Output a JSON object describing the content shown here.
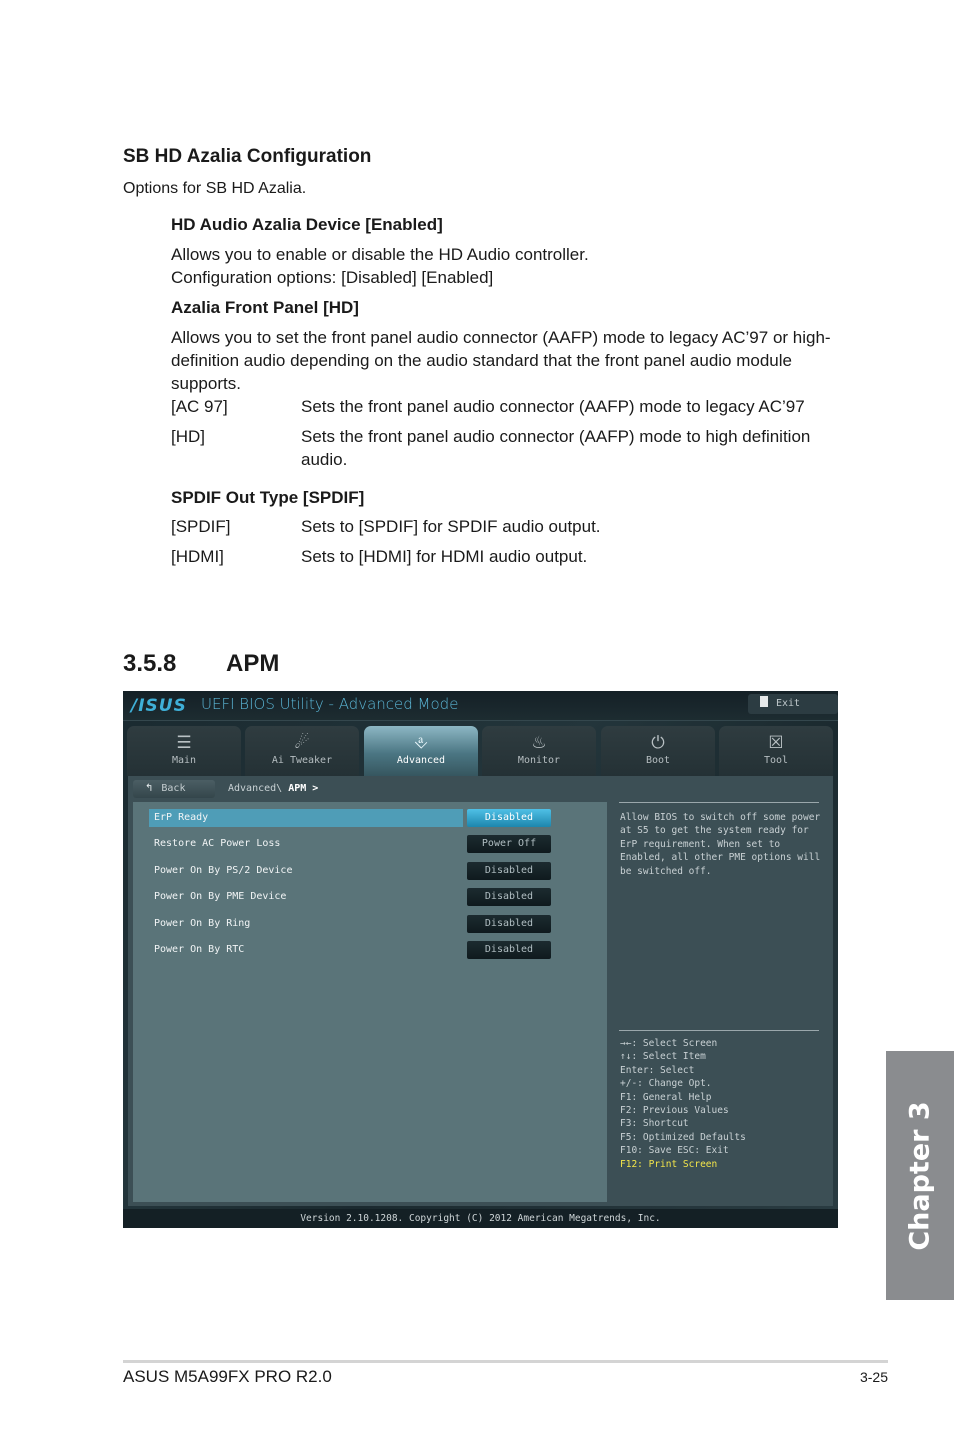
{
  "document": {
    "section": {
      "title": "SB HD Azalia Configuration",
      "intro": "Options for SB HD Azalia.",
      "items": [
        {
          "title": "HD Audio Azalia Device [Enabled]",
          "lines": [
            "Allows you to enable or disable the HD Audio controller.",
            "Configuration options: [Disabled] [Enabled]"
          ]
        },
        {
          "title": "Azalia Front Panel [HD]",
          "description": "Allows you to set the front panel audio connector (AAFP) mode to legacy AC’97 or high-definition audio depending on the audio standard that the front panel audio module supports.",
          "options": [
            {
              "key": "[AC 97]",
              "desc": "Sets the front panel audio connector (AAFP) mode to legacy AC’97"
            },
            {
              "key": "[HD]",
              "desc": "Sets the front panel audio connector (AAFP) mode to high definition audio."
            }
          ]
        },
        {
          "title": "SPDIF Out Type [SPDIF]",
          "options": [
            {
              "key": "[SPDIF]",
              "desc": "Sets to [SPDIF] for SPDIF audio output."
            },
            {
              "key": "[HDMI]",
              "desc": "Sets to [HDMI] for HDMI audio output."
            }
          ]
        }
      ]
    },
    "apm_heading": {
      "number": "3.5.8",
      "title": "APM"
    }
  },
  "bios": {
    "brand": "/ISUS",
    "title": "UEFI BIOS Utility - Advanced Mode",
    "exit_label": "Exit",
    "tabs": [
      {
        "label": "Main",
        "icon": "list-icon",
        "glyph": "☰"
      },
      {
        "label": "Ai Tweaker",
        "icon": "tweaker-icon",
        "glyph": "☄"
      },
      {
        "label": "Advanced",
        "icon": "advanced-icon",
        "glyph": "⎀",
        "active": true
      },
      {
        "label": "Monitor",
        "icon": "thermometer-icon",
        "glyph": "♨"
      },
      {
        "label": "Boot",
        "icon": "power-icon",
        "glyph": "⏻"
      },
      {
        "label": "Tool",
        "icon": "toolbox-icon",
        "glyph": "☒"
      }
    ],
    "back_label": "Back",
    "breadcrumb": {
      "parent": "Advanced\\",
      "current": "APM >"
    },
    "settings": [
      {
        "name": "ErP Ready",
        "value": "Disabled",
        "selected": true
      },
      {
        "name": "Restore AC Power Loss",
        "value": "Power Off"
      },
      {
        "name": "Power On By PS/2 Device",
        "value": "Disabled"
      },
      {
        "name": "Power On By PME Device",
        "value": "Disabled"
      },
      {
        "name": "Power On By Ring",
        "value": "Disabled"
      },
      {
        "name": "Power On By RTC",
        "value": "Disabled"
      }
    ],
    "help_text": "Allow BIOS to switch off some power\nat S5 to get the system ready for\nErP requirement. When set to\nEnabled, all other PME options will\nbe switched off.",
    "key_hints": [
      "→←: Select Screen",
      "↑↓: Select Item",
      "Enter: Select",
      "+/-: Change Opt.",
      "F1: General Help",
      "F2: Previous Values",
      "F3: Shortcut",
      "F5: Optimized Defaults",
      "F10: Save  ESC: Exit",
      "F12: Print Screen"
    ],
    "version": "Version 2.10.1208. Copyright (C) 2012 American Megatrends, Inc.",
    "colors": {
      "accent": "#4f9db7",
      "highlight_key": "#f4e64a",
      "panel": "#5a7479"
    }
  },
  "chapter_tab": "Chapter 3",
  "footer": {
    "product": "ASUS M5A99FX PRO R2.0",
    "page": "3-25"
  }
}
